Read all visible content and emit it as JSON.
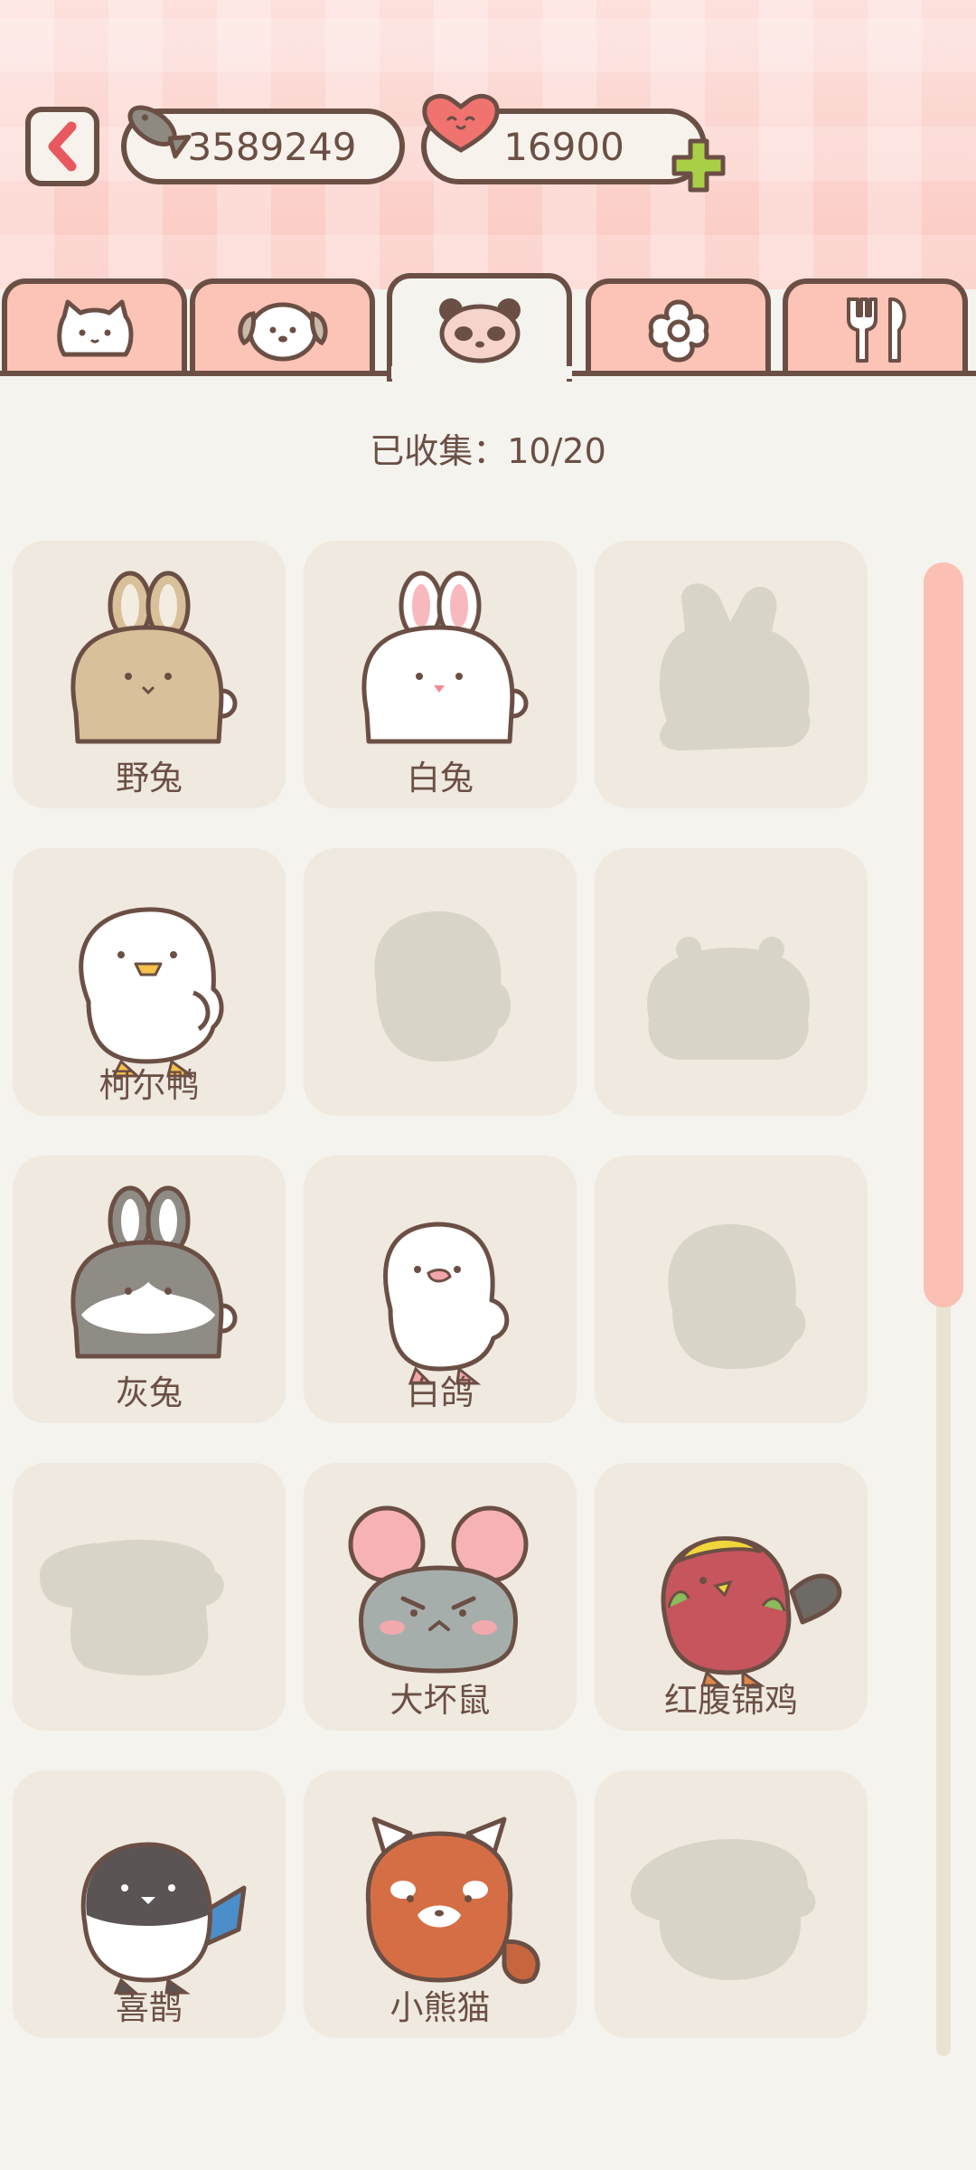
{
  "currency": {
    "fish": "3589249",
    "hearts": "16900"
  },
  "tabs": [
    {
      "name": "cat",
      "active": false
    },
    {
      "name": "dog",
      "active": false
    },
    {
      "name": "panda",
      "active": true
    },
    {
      "name": "flower",
      "active": false
    },
    {
      "name": "cutlery",
      "active": false
    }
  ],
  "collection": {
    "label": "已收集：10/20"
  },
  "animals": [
    {
      "name": "野兔",
      "locked": false
    },
    {
      "name": "白兔",
      "locked": false
    },
    {
      "name": "",
      "locked": true
    },
    {
      "name": "柯尔鸭",
      "locked": false
    },
    {
      "name": "",
      "locked": true
    },
    {
      "name": "",
      "locked": true
    },
    {
      "name": "灰兔",
      "locked": false
    },
    {
      "name": "白鸽",
      "locked": false
    },
    {
      "name": "",
      "locked": true
    },
    {
      "name": "",
      "locked": true
    },
    {
      "name": "大坏鼠",
      "locked": false
    },
    {
      "name": "红腹锦鸡",
      "locked": false
    },
    {
      "name": "喜鹊",
      "locked": false
    },
    {
      "name": "小熊猫",
      "locked": false
    },
    {
      "name": "",
      "locked": true
    }
  ],
  "colors": {
    "accent": "#fcc3b7",
    "outline": "#6b4f45",
    "card": "#efe9df",
    "locked": "#d9d4c8"
  }
}
